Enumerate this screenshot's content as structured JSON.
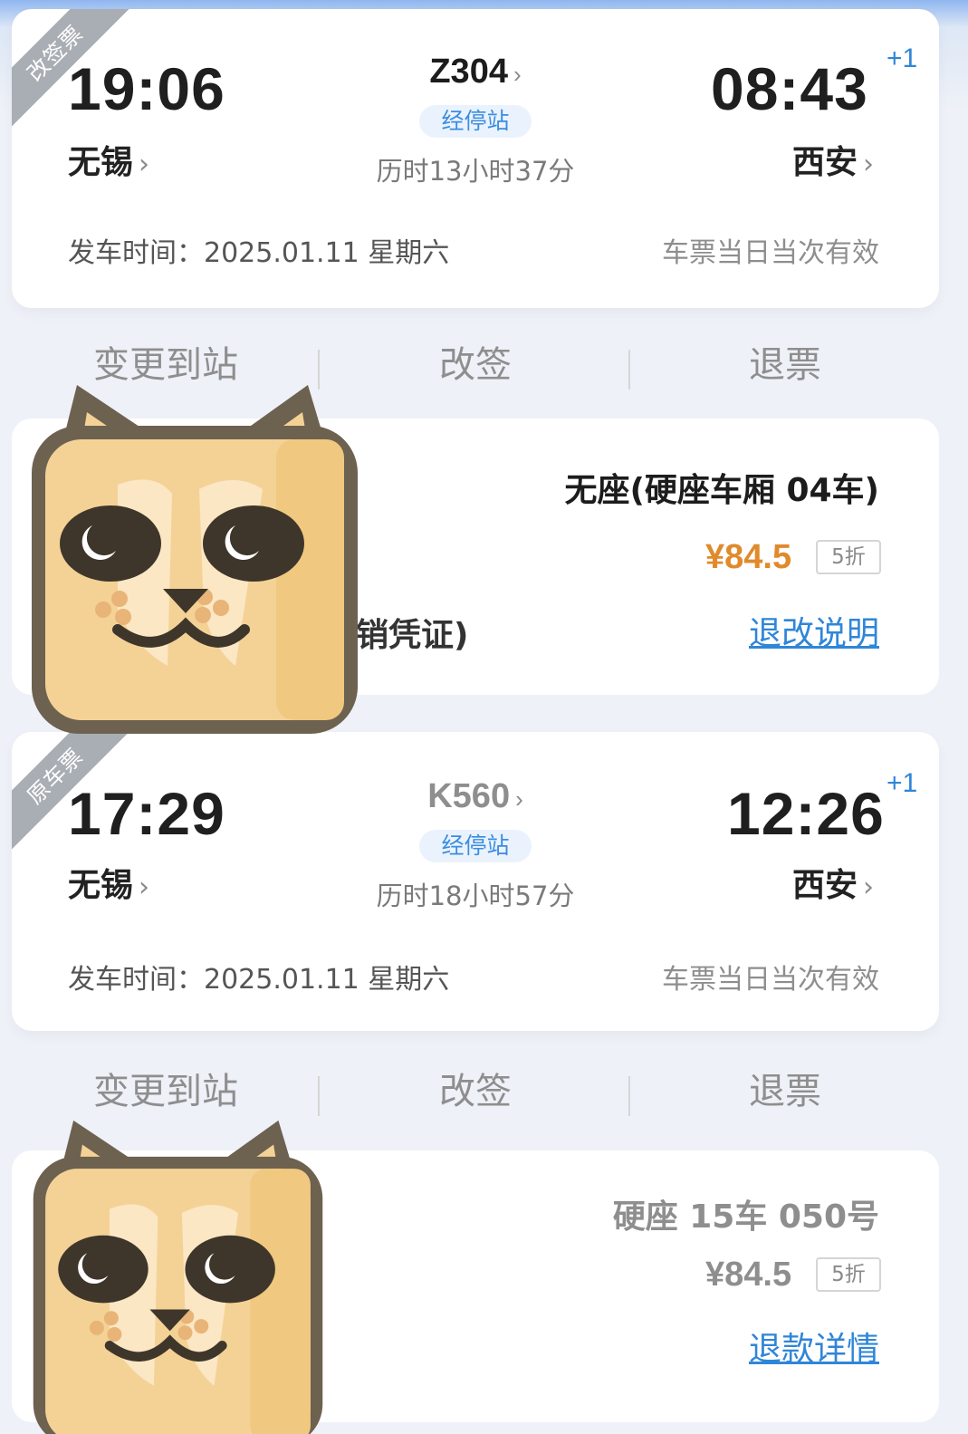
{
  "new_ticket": {
    "ribbon": "改签票",
    "depart_time": "19:06",
    "arrive_time": "08:43",
    "day_offset": "+1",
    "from_station": "无锡",
    "to_station": "西安",
    "train_no": "Z304",
    "stops_label": "经停站",
    "duration": "历时13小时37分",
    "depart_date": "发车时间：2025.01.11 星期六",
    "validity": "车票当日当次有效",
    "seat": "无座(硬座车厢 04车)",
    "price": "¥84.5",
    "discount": "5折",
    "partial_text": "销凭证)",
    "link": "退改说明",
    "price_color": "#e08a2c"
  },
  "old_ticket": {
    "ribbon": "原车票",
    "depart_time": "17:29",
    "arrive_time": "12:26",
    "day_offset": "+1",
    "from_station": "无锡",
    "to_station": "西安",
    "train_no": "K560",
    "stops_label": "经停站",
    "duration": "历时18小时57分",
    "depart_date": "发车时间：2025.01.11 星期六",
    "validity": "车票当日当次有效",
    "seat": "硬座 15车 050号",
    "price": "¥84.5",
    "discount": "5折",
    "link": "退款详情",
    "price_color": "#8e8e8e"
  },
  "actions": {
    "change_station": "变更到站",
    "reschedule": "改签",
    "refund": "退票"
  },
  "chevron": "›",
  "colors": {
    "accent": "#2f86d8",
    "price_highlight": "#e08a2c",
    "ribbon": "#a9adb4",
    "sticker_face": "#f4d296"
  }
}
